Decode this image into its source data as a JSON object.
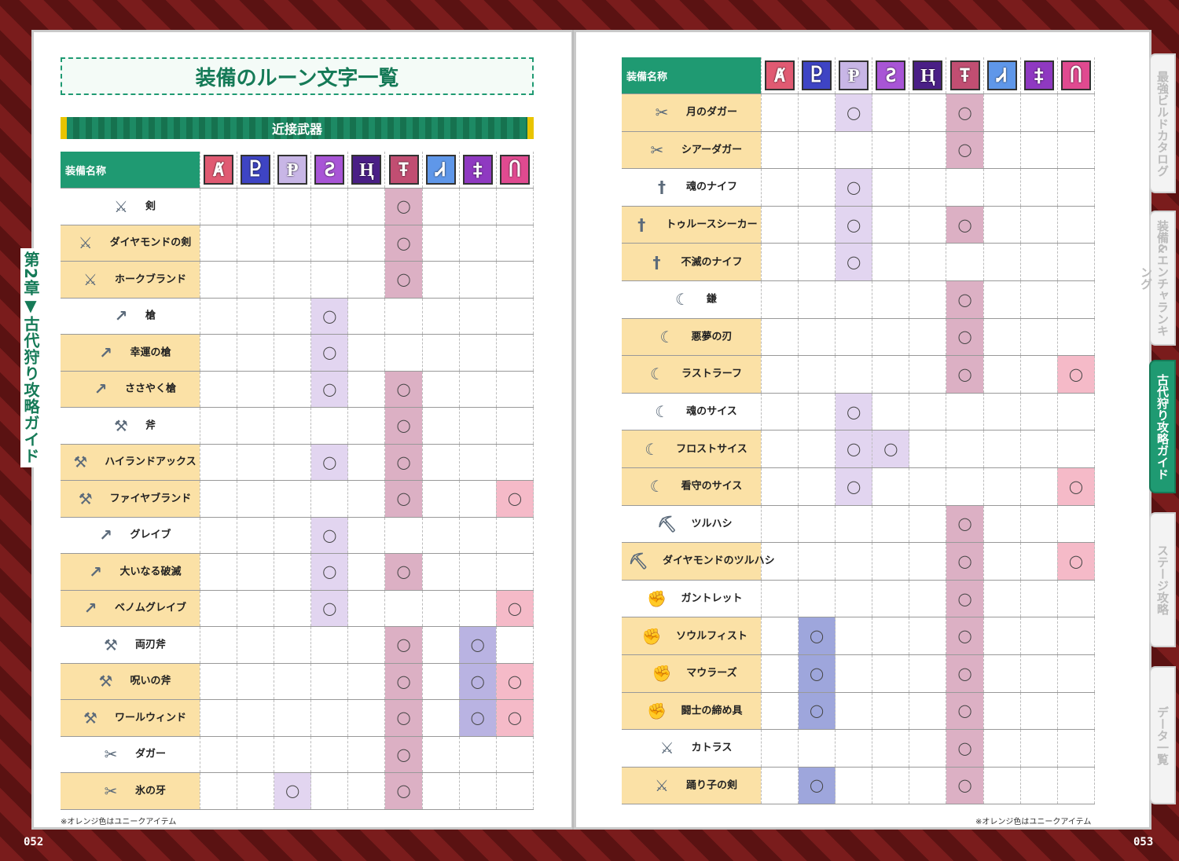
{
  "runes": [
    {
      "glyph": "Ⱥ",
      "color": "#e05a72"
    },
    {
      "glyph": "Ⴒ",
      "color": "#3e44c4"
    },
    {
      "glyph": "Ᵽ",
      "color": "#c8b6e6"
    },
    {
      "glyph": "Ƨ",
      "color": "#a855d6"
    },
    {
      "glyph": "Ⱨ",
      "color": "#4a1f86"
    },
    {
      "glyph": "Ŧ",
      "color": "#c14e72"
    },
    {
      "glyph": "Ꮧ",
      "color": "#5f97e9"
    },
    {
      "glyph": "‡",
      "color": "#8f39c1"
    },
    {
      "glyph": "Ⴖ",
      "color": "#e04a90"
    }
  ],
  "rune_cell_colors": [
    "#f6c8d4",
    "#9ea6dc",
    "#e2d5f0",
    "#e2d5f0",
    "#d4c4ec",
    "#dcb0c4",
    "#c2d8f4",
    "#b9b3e2",
    "#f5bac8"
  ],
  "mark_symbol": "◯",
  "left": {
    "title": "装備のルーン文字一覧",
    "section": "近接武器",
    "header_name": "装備名称",
    "items": [
      {
        "name": "剣",
        "icon": "⚔",
        "unique": false,
        "marks": [
          5
        ]
      },
      {
        "name": "ダイヤモンドの剣",
        "icon": "⚔",
        "unique": true,
        "marks": [
          5
        ]
      },
      {
        "name": "ホークブランド",
        "icon": "⚔",
        "unique": true,
        "marks": [
          5
        ]
      },
      {
        "name": "槍",
        "icon": "↗",
        "unique": false,
        "marks": [
          3
        ]
      },
      {
        "name": "幸運の槍",
        "icon": "↗",
        "unique": true,
        "marks": [
          3
        ]
      },
      {
        "name": "ささやく槍",
        "icon": "↗",
        "unique": true,
        "marks": [
          3,
          5
        ]
      },
      {
        "name": "斧",
        "icon": "⚒",
        "unique": false,
        "marks": [
          5
        ]
      },
      {
        "name": "ハイランドアックス",
        "icon": "⚒",
        "unique": true,
        "marks": [
          3,
          5
        ]
      },
      {
        "name": "ファイヤブランド",
        "icon": "⚒",
        "unique": true,
        "marks": [
          5,
          8
        ]
      },
      {
        "name": "グレイブ",
        "icon": "↗",
        "unique": false,
        "marks": [
          3
        ]
      },
      {
        "name": "大いなる破滅",
        "icon": "↗",
        "unique": true,
        "marks": [
          3,
          5
        ]
      },
      {
        "name": "ベノムグレイブ",
        "icon": "↗",
        "unique": true,
        "marks": [
          3,
          8
        ]
      },
      {
        "name": "両刃斧",
        "icon": "⚒",
        "unique": false,
        "marks": [
          5,
          7
        ]
      },
      {
        "name": "呪いの斧",
        "icon": "⚒",
        "unique": true,
        "marks": [
          5,
          7,
          8
        ]
      },
      {
        "name": "ワールウィンド",
        "icon": "⚒",
        "unique": true,
        "marks": [
          5,
          7,
          8
        ]
      },
      {
        "name": "ダガー",
        "icon": "✂",
        "unique": false,
        "marks": [
          5
        ]
      },
      {
        "name": "氷の牙",
        "icon": "✂",
        "unique": true,
        "marks": [
          2,
          5
        ]
      }
    ],
    "footnote": "※オレンジ色はユニークアイテム",
    "page_number": "052",
    "chapter_label": "第2章▼古代狩り攻略ガイド"
  },
  "right": {
    "header_name": "装備名称",
    "items": [
      {
        "name": "月のダガー",
        "icon": "✂",
        "unique": true,
        "marks": [
          2,
          5
        ]
      },
      {
        "name": "シアーダガー",
        "icon": "✂",
        "unique": true,
        "marks": [
          5
        ]
      },
      {
        "name": "魂のナイフ",
        "icon": "†",
        "unique": false,
        "marks": [
          2
        ]
      },
      {
        "name": "トゥルースシーカー",
        "icon": "†",
        "unique": true,
        "marks": [
          2,
          5
        ]
      },
      {
        "name": "不滅のナイフ",
        "icon": "†",
        "unique": true,
        "marks": [
          2
        ]
      },
      {
        "name": "鎌",
        "icon": "☾",
        "unique": false,
        "marks": [
          5
        ]
      },
      {
        "name": "悪夢の刃",
        "icon": "☾",
        "unique": true,
        "marks": [
          5
        ]
      },
      {
        "name": "ラストラーフ",
        "icon": "☾",
        "unique": true,
        "marks": [
          5,
          8
        ]
      },
      {
        "name": "魂のサイス",
        "icon": "☾",
        "unique": false,
        "marks": [
          2
        ]
      },
      {
        "name": "フロストサイス",
        "icon": "☾",
        "unique": true,
        "marks": [
          2,
          3
        ]
      },
      {
        "name": "看守のサイス",
        "icon": "☾",
        "unique": true,
        "marks": [
          2,
          8
        ]
      },
      {
        "name": "ツルハシ",
        "icon": "⛏",
        "unique": false,
        "marks": [
          5
        ]
      },
      {
        "name": "ダイヤモンドのツルハシ",
        "icon": "⛏",
        "unique": true,
        "marks": [
          5,
          8
        ]
      },
      {
        "name": "ガントレット",
        "icon": "✊",
        "unique": false,
        "marks": [
          5
        ]
      },
      {
        "name": "ソウルフィスト",
        "icon": "✊",
        "unique": true,
        "marks": [
          1,
          5
        ]
      },
      {
        "name": "マウラーズ",
        "icon": "✊",
        "unique": true,
        "marks": [
          1,
          5
        ]
      },
      {
        "name": "闘士の締め具",
        "icon": "✊",
        "unique": true,
        "marks": [
          1,
          5
        ]
      },
      {
        "name": "カトラス",
        "icon": "⚔",
        "unique": false,
        "marks": [
          5
        ]
      },
      {
        "name": "踊り子の剣",
        "icon": "⚔",
        "unique": true,
        "marks": [
          1,
          5
        ]
      }
    ],
    "footnote": "※オレンジ色はユニークアイテム",
    "page_number": "053"
  },
  "side_tabs": [
    {
      "label": "最強ビルドカタログ",
      "active": false
    },
    {
      "label": "装備&エンチャランキング",
      "active": false
    },
    {
      "label": "古代狩り攻略ガイド",
      "active": true
    },
    {
      "label": "ステージ攻略",
      "active": false
    },
    {
      "label": "データ一覧",
      "active": false
    }
  ]
}
